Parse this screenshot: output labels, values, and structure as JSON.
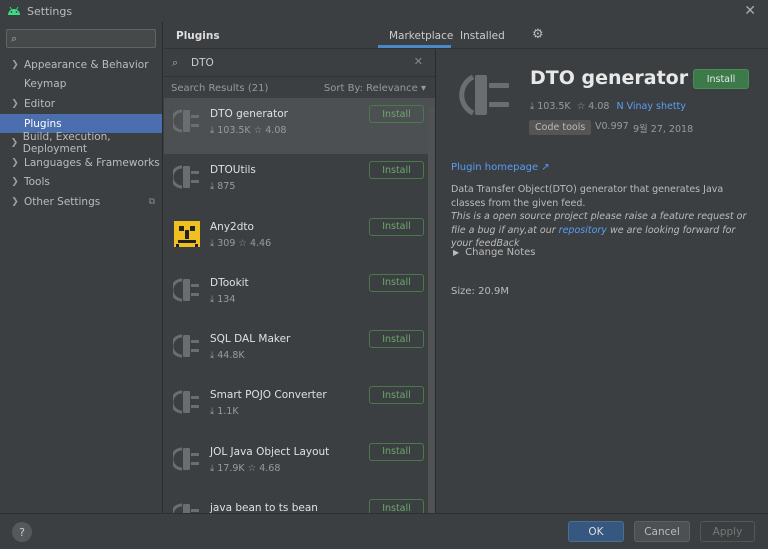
{
  "window": {
    "title": "Settings"
  },
  "sidebar": {
    "search_value": "",
    "items": [
      {
        "label": "Appearance & Behavior",
        "expandable": true,
        "selected": false
      },
      {
        "label": "Keymap",
        "expandable": false,
        "selected": false
      },
      {
        "label": "Editor",
        "expandable": true,
        "selected": false
      },
      {
        "label": "Plugins",
        "expandable": false,
        "selected": true
      },
      {
        "label": "Build, Execution, Deployment",
        "expandable": true,
        "selected": false
      },
      {
        "label": "Languages & Frameworks",
        "expandable": true,
        "selected": false
      },
      {
        "label": "Tools",
        "expandable": true,
        "selected": false
      },
      {
        "label": "Other Settings",
        "expandable": true,
        "selected": false
      }
    ]
  },
  "header": {
    "title": "Plugins",
    "tabs": [
      {
        "label": "Marketplace",
        "active": true
      },
      {
        "label": "Installed",
        "active": false
      }
    ]
  },
  "plugin_search": {
    "value": "DTO"
  },
  "results": {
    "count_label": "Search Results (21)",
    "sort_label": "Sort By: Relevance"
  },
  "plugins": [
    {
      "name": "DTO generator",
      "downloads": "103.5K",
      "rating": "4.08",
      "button": "Install",
      "icon": "plug-icon",
      "selected": true
    },
    {
      "name": "DTOUtils",
      "downloads": "875",
      "rating": "",
      "button": "Install",
      "icon": "plug-icon",
      "selected": false
    },
    {
      "name": "Any2dto",
      "downloads": "309",
      "rating": "4.46",
      "button": "Install",
      "icon": "any2dto-logo-icon",
      "selected": false
    },
    {
      "name": "DTookit",
      "downloads": "134",
      "rating": "",
      "button": "Install",
      "icon": "plug-icon",
      "selected": false
    },
    {
      "name": "SQL DAL Maker",
      "downloads": "44.8K",
      "rating": "",
      "button": "Install",
      "icon": "plug-icon",
      "selected": false
    },
    {
      "name": "Smart POJO Converter",
      "downloads": "1.1K",
      "rating": "",
      "button": "Install",
      "icon": "plug-icon",
      "selected": false
    },
    {
      "name": "JOL Java Object Layout",
      "downloads": "17.9K",
      "rating": "4.68",
      "button": "Install",
      "icon": "plug-icon",
      "selected": false
    },
    {
      "name": "java bean to ts bean",
      "downloads": "",
      "rating": "",
      "button": "Install",
      "icon": "plug-icon",
      "selected": false
    }
  ],
  "detail": {
    "name": "DTO generator",
    "install_label": "Install",
    "downloads": "103.5K",
    "rating": "4.08",
    "vendor": "N Vinay shetty",
    "category": "Code tools",
    "version": "V0.997",
    "date": "9월 27, 2018",
    "homepage_label": "Plugin homepage",
    "description_line1": "Data Transfer Object(DTO) generator that generates Java classes from the given feed.",
    "description_italic_pre": "This is a open source project please raise a feature request or file a bug if any,at our",
    "description_link": "repository",
    "description_italic_post": "we are looking forward for your feedBack",
    "change_notes_label": "Change Notes",
    "size_label": "Size: 20.9M"
  },
  "footer": {
    "help_label": "?",
    "ok_label": "OK",
    "cancel_label": "Cancel",
    "apply_label": "Apply"
  },
  "colors": {
    "selection": "#4b6eaf",
    "install_green": "#3d7a49",
    "link": "#589df6",
    "tab_underline": "#4a88c7"
  }
}
